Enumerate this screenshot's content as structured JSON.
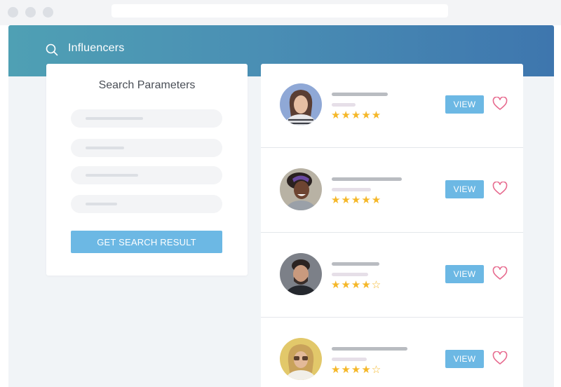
{
  "header": {
    "title": "Influencers",
    "icon": "search-icon"
  },
  "search_parameters": {
    "title": "Search Parameters",
    "button_label": "GET SEARCH RESULT"
  },
  "results": [
    {
      "rating": 5,
      "stars": "★★★★★",
      "view_label": "VIEW"
    },
    {
      "rating": 5,
      "stars": "★★★★★",
      "view_label": "VIEW"
    },
    {
      "rating": 4,
      "stars": "★★★★☆",
      "view_label": "VIEW"
    },
    {
      "rating": 4,
      "stars": "★★★★☆",
      "view_label": "VIEW"
    }
  ],
  "colors": {
    "header_start": "#4fa0b4",
    "header_end": "#3e76ae",
    "button": "#6cb8e4",
    "star": "#f5b728",
    "heart": "#e76a8e"
  }
}
